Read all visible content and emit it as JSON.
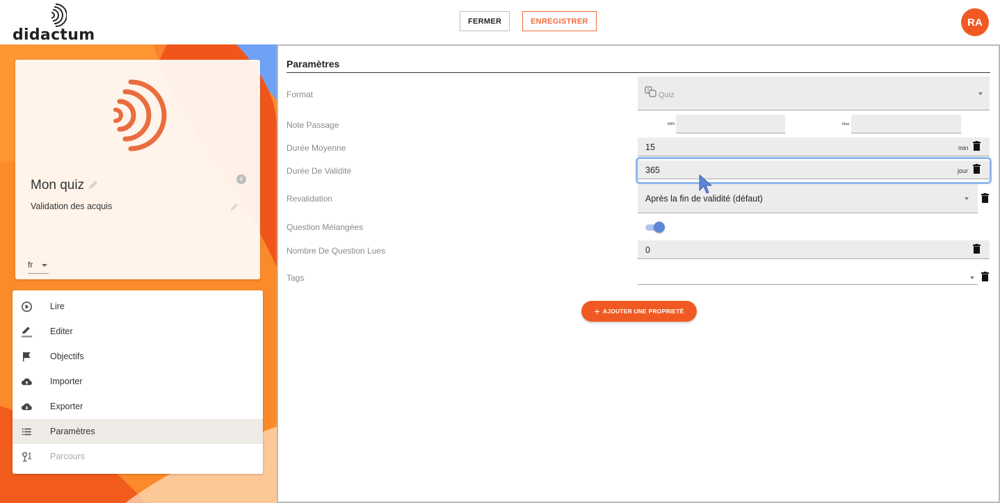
{
  "app": {
    "logo_text": "didactum"
  },
  "header": {
    "close_label": "FERMER",
    "save_label": "ENREGISTRER",
    "avatar_initials": "RA"
  },
  "quiz": {
    "title": "Mon quiz",
    "subtitle": "Validation des acquis",
    "hash_glyph": "#",
    "language": "fr"
  },
  "menu": {
    "items": [
      {
        "label": "Lire",
        "icon": "play-circle-icon"
      },
      {
        "label": "Editer",
        "icon": "pencil-icon"
      },
      {
        "label": "Objectifs",
        "icon": "flag-icon"
      },
      {
        "label": "Importer",
        "icon": "cloud-upload-icon"
      },
      {
        "label": "Exporter",
        "icon": "cloud-download-icon"
      },
      {
        "label": "Paramètres",
        "icon": "list-icon",
        "active": true
      },
      {
        "label": "Parcours",
        "icon": "route-icon",
        "disabled": true
      }
    ]
  },
  "settings": {
    "title": "Paramètres",
    "format": {
      "label": "Format",
      "value": "Quiz",
      "icon": "quiz-icon"
    },
    "pass_mark": {
      "label": "Note Passage",
      "min_label": "MIN",
      "max_label": "Max",
      "min_value": "",
      "max_value": ""
    },
    "avg_duration": {
      "label": "Durée Moyenne",
      "value": "15",
      "unit": "min"
    },
    "validity": {
      "label": "Durée De Validité",
      "value": "365",
      "unit": "jour"
    },
    "revalidation": {
      "label": "Revalidation",
      "value": "Après la fin de validité (défaut)"
    },
    "shuffle": {
      "label": "Question Mélangées",
      "enabled": true
    },
    "questions_read": {
      "label": "Nombre De Question Lues",
      "value": "0"
    },
    "tags": {
      "label": "Tags",
      "value": ""
    },
    "add_property_label": "AJOUTER UNE PROPRIETÉ"
  },
  "colors": {
    "accent": "#f05a22",
    "focus": "#8fb6ea",
    "toggle": "#5f86d4"
  }
}
